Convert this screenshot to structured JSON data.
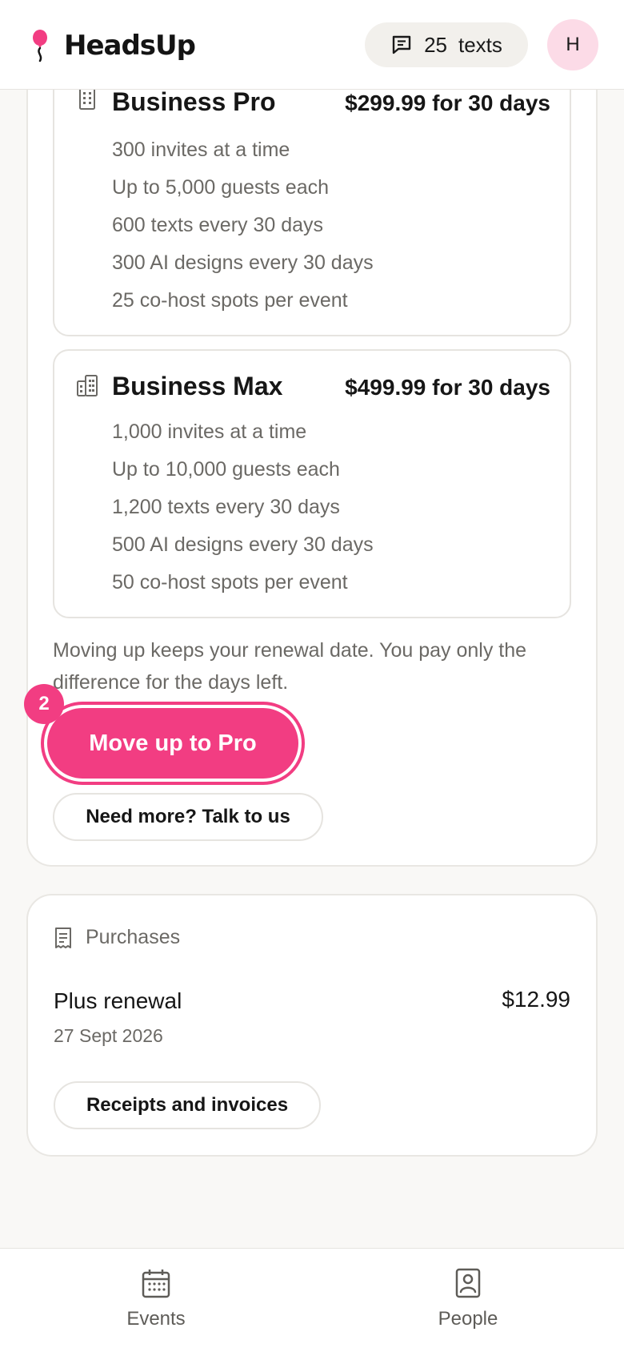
{
  "header": {
    "brand": "HeadsUp",
    "texts_count": "25",
    "texts_label": "texts",
    "avatar_initial": "H"
  },
  "plans": [
    {
      "name": "Business Pro",
      "price": "$299.99 for 30 days",
      "icon": "building-icon",
      "features": [
        "300 invites at a time",
        "Up to 5,000 guests each",
        "600 texts every 30 days",
        "300 AI designs every 30 days",
        "25 co-host spots per event"
      ]
    },
    {
      "name": "Business Max",
      "price": "$499.99 for 30 days",
      "icon": "buildings-icon",
      "features": [
        "1,000 invites at a time",
        "Up to 10,000 guests each",
        "1,200 texts every 30 days",
        "500 AI designs every 30 days",
        "50 co-host spots per event"
      ]
    }
  ],
  "upgrade": {
    "note": "Moving up keeps your renewal date. You pay only the difference for the days left.",
    "step_badge": "2",
    "primary_label": "Move up to Pro",
    "talk_label": "Need more? Talk to us"
  },
  "purchases": {
    "heading": "Purchases",
    "item_name": "Plus renewal",
    "item_date": "27 Sept 2026",
    "item_price": "$12.99",
    "receipts_label": "Receipts and invoices"
  },
  "nav": {
    "events_label": "Events",
    "people_label": "People"
  },
  "colors": {
    "accent": "#f23d82",
    "avatar_bg": "#fcdbe7",
    "muted_text": "#6b6965"
  }
}
